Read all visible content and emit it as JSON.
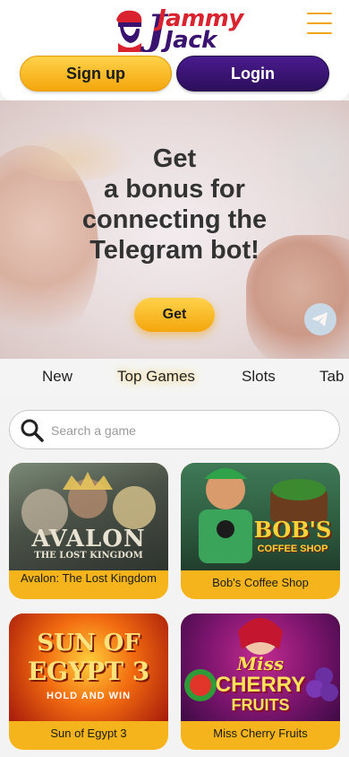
{
  "header": {
    "logo_word1": "Jammy",
    "logo_word2": "Jack",
    "logo_j": "J"
  },
  "auth": {
    "signup_label": "Sign up",
    "login_label": "Login"
  },
  "banner": {
    "lines": [
      "Get",
      "a bonus for",
      "connecting the",
      "Telegram bot!"
    ],
    "cta_label": "Get"
  },
  "tabs": [
    "New",
    "Top Games",
    "Slots",
    "Tab"
  ],
  "search": {
    "placeholder": "Search a game"
  },
  "games": [
    {
      "title": "Avalon: The Lost Kingdom",
      "art_text_1": "AVALON",
      "art_text_2": "THE LOST KINGDOM"
    },
    {
      "title": "Bob's Coffee Shop",
      "art_text_1": "BOB'S",
      "art_text_2": "COFFEE SHOP"
    },
    {
      "title": "Sun of Egypt 3",
      "art_text_1": "SUN OF",
      "art_text_2": "EGYPT 3",
      "art_text_3": "HOLD AND WIN"
    },
    {
      "title": "Miss Cherry Fruits",
      "art_text_1": "Miss",
      "art_text_2": "CHERRY",
      "art_text_3": "FRUITS"
    }
  ],
  "colors": {
    "accent_yellow": "#f4a60c",
    "brand_purple": "#2c0f5c",
    "brand_red": "#d9232e"
  },
  "icons": [
    "mascot-logo",
    "menu-icon",
    "telegram-icon",
    "search-icon"
  ]
}
